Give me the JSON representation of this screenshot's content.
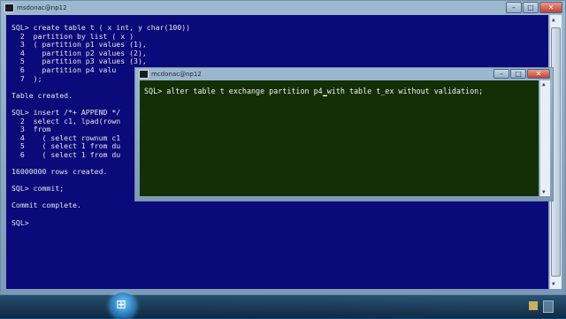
{
  "main_window": {
    "title": "msdonac@np12",
    "lines": [
      "SQL> create table t ( x int, y char(100))",
      "  2  partition by list ( x )",
      "  3  ( partition p1 values (1),",
      "  4    partition p2 values (2),",
      "  5    partition p3 values (3),",
      "  6    partition p4 valu",
      "  7  );",
      "",
      "Table created.",
      "",
      "SQL> insert /*+ APPEND */",
      "  2  select c1, lpad(rown",
      "  3  from",
      "  4    ( select rownum c1",
      "  5    ( select 1 from du",
      "  6    ( select 1 from du",
      "",
      "16000000 rows created.",
      "",
      "SQL> commit;",
      "",
      "Commit complete.",
      "",
      "SQL>"
    ]
  },
  "overlay_window": {
    "title": "mcdonac@np12",
    "prompt": "SQL> alter table t exchange partition p4",
    "cursor_char": "_",
    "rest": "with table t_ex without validation;"
  },
  "window_controls": {
    "minimize": "–",
    "maximize": "□",
    "close": "✕"
  },
  "taskbar": {
    "start_glyph": "⊞"
  },
  "colors": {
    "console_bg": "#0a0a7a",
    "overlay_bg": "#142e06",
    "text": "#e6e6e6"
  }
}
